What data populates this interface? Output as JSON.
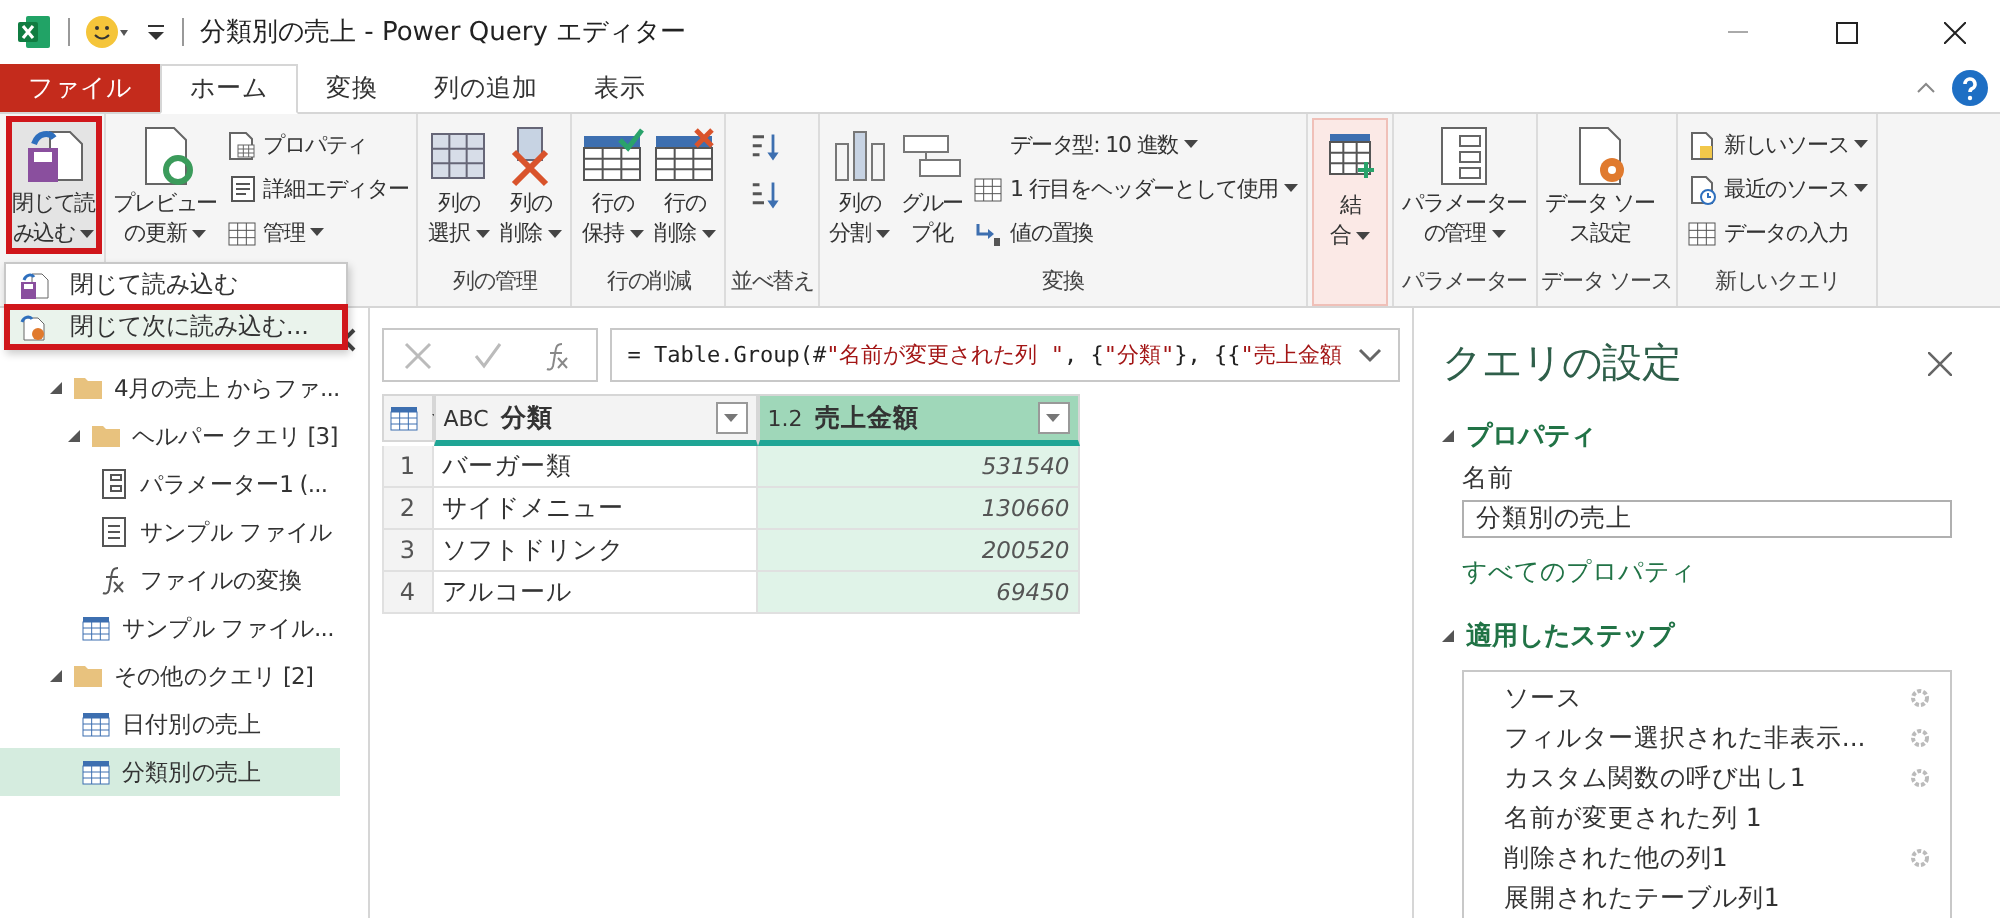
{
  "window": {
    "title": "分類別の売上 - Power Query エディター"
  },
  "tabs": [
    {
      "label": "ファイル",
      "kind": "file",
      "selected": false
    },
    {
      "label": "ホーム",
      "kind": "tab",
      "selected": true
    },
    {
      "label": "変換",
      "kind": "tab",
      "selected": false
    },
    {
      "label": "列の追加",
      "kind": "tab",
      "selected": false
    },
    {
      "label": "表示",
      "kind": "tab",
      "selected": false
    }
  ],
  "ribbon": [
    {
      "items": [
        {
          "kind": "large",
          "lines": [
            "閉じて読",
            "み込む"
          ],
          "dropdown": true,
          "highlighted": true,
          "hovered": false
        }
      ]
    },
    {
      "items": [
        {
          "kind": "large",
          "lines": [
            "プレビュー",
            "の更新"
          ],
          "dropdown": true,
          "highlighted": false,
          "hovered": false
        },
        {
          "kind": "stack",
          "items": [
            {
              "label": "プロパティ",
              "dropdown": false
            },
            {
              "label": "詳細エディター",
              "dropdown": false
            },
            {
              "label": "管理",
              "dropdown": true
            }
          ]
        }
      ]
    },
    {
      "label": "列の管理",
      "items": [
        {
          "kind": "large",
          "lines": [
            "列の",
            "選択"
          ],
          "dropdown": true,
          "highlighted": false,
          "hovered": false
        },
        {
          "kind": "large",
          "lines": [
            "列の",
            "削除"
          ],
          "dropdown": true,
          "highlighted": false,
          "hovered": false
        }
      ]
    },
    {
      "label": "行の削減",
      "items": [
        {
          "kind": "large",
          "lines": [
            "行の",
            "保持"
          ],
          "dropdown": true,
          "highlighted": false,
          "hovered": false
        },
        {
          "kind": "large",
          "lines": [
            "行の",
            "削除"
          ],
          "dropdown": true,
          "highlighted": false,
          "hovered": false
        }
      ]
    },
    {
      "label": "並べ替え",
      "items": [
        {
          "kind": "sort"
        }
      ]
    },
    {
      "label": "変換",
      "items": [
        {
          "kind": "large",
          "lines": [
            "列の",
            "分割"
          ],
          "dropdown": true,
          "highlighted": false,
          "hovered": false
        },
        {
          "kind": "large",
          "lines": [
            "グルー",
            "プ化"
          ],
          "dropdown": false,
          "highlighted": false,
          "hovered": false
        },
        {
          "kind": "stack",
          "items": [
            {
              "label": "データ型: 10 進数",
              "dropdown": true
            },
            {
              "label": "1 行目をヘッダーとして使用",
              "dropdown": true
            },
            {
              "label": "値の置換",
              "dropdown": false
            }
          ]
        }
      ]
    },
    {
      "items": [
        {
          "kind": "large",
          "lines": [
            "結",
            "合"
          ],
          "dropdown": true,
          "highlighted": false,
          "hovered": true
        }
      ]
    },
    {
      "label": "パラメーター",
      "items": [
        {
          "kind": "large",
          "lines": [
            "パラメーター",
            "の管理"
          ],
          "dropdown": true,
          "highlighted": false,
          "hovered": false
        }
      ]
    },
    {
      "label": "データ ソース",
      "items": [
        {
          "kind": "large",
          "lines": [
            "データ ソー",
            "ス設定"
          ],
          "dropdown": false,
          "highlighted": false,
          "hovered": false
        }
      ]
    },
    {
      "label": "新しいクエリ",
      "items": [
        {
          "kind": "stack",
          "items": [
            {
              "label": "新しいソース",
              "dropdown": true
            },
            {
              "label": "最近のソース",
              "dropdown": true
            },
            {
              "label": "データの入力",
              "dropdown": false
            }
          ]
        }
      ]
    }
  ],
  "menu": [
    {
      "label": "閉じて読み込む",
      "highlighted": false
    },
    {
      "label": "閉じて次に読み込む...",
      "highlighted": true
    }
  ],
  "queries": [
    {
      "label": "4月の売上 からファ...",
      "kind": "folder",
      "expanded": true,
      "children": [
        {
          "label": "ヘルパー クエリ [3]",
          "kind": "folder",
          "expanded": true,
          "children": [
            {
              "label": "パラメーター1 (...",
              "kind": "parameter",
              "selected": false
            },
            {
              "label": "サンプル ファイル",
              "kind": "list",
              "selected": false
            },
            {
              "label": "ファイルの変換",
              "kind": "function",
              "selected": false
            }
          ]
        },
        {
          "label": "サンプル ファイル...",
          "kind": "table",
          "selected": false
        }
      ]
    },
    {
      "label": "その他のクエリ [2]",
      "kind": "folder",
      "expanded": true,
      "children": [
        {
          "label": "日付別の売上",
          "kind": "table",
          "selected": false
        },
        {
          "label": "分類別の売上",
          "kind": "table",
          "selected": true
        }
      ]
    }
  ],
  "formula": [
    {
      "kind": "code",
      "text": "= Table.Group(#"
    },
    {
      "kind": "string",
      "text": "\"名前が変更された列 \""
    },
    {
      "kind": "code",
      "text": ", {"
    },
    {
      "kind": "string",
      "text": "\"分類\""
    },
    {
      "kind": "code",
      "text": "}, {{"
    },
    {
      "kind": "string",
      "text": "\"売上金額"
    }
  ],
  "table": {
    "columns": [
      {
        "type": "ABC",
        "name": "分類",
        "selected": false
      },
      {
        "type": "1.2",
        "name": "売上金額",
        "selected": true
      }
    ],
    "rows": [
      {
        "index": "1",
        "cells": [
          "バーガー類",
          "531540"
        ]
      },
      {
        "index": "2",
        "cells": [
          "サイドメニュー",
          "130660"
        ]
      },
      {
        "index": "3",
        "cells": [
          "ソフトドリンク",
          "200520"
        ]
      },
      {
        "index": "4",
        "cells": [
          "アルコール",
          "69450"
        ]
      }
    ]
  },
  "settings": {
    "title": "クエリの設定",
    "properties": {
      "heading": "プロパティ",
      "expanded": true,
      "name_label": "名前",
      "name_value": "分類別の売上",
      "link": "すべてのプロパティ"
    },
    "steps_section": {
      "heading": "適用したステップ",
      "expanded": true
    },
    "steps": [
      {
        "label": "ソース",
        "settings": true
      },
      {
        "label": "フィルター選択された非表示...",
        "settings": true
      },
      {
        "label": "カスタム関数の呼び出し1",
        "settings": true
      },
      {
        "label": "名前が変更された列 1",
        "settings": false
      },
      {
        "label": "削除された他の列1",
        "settings": true
      },
      {
        "label": "展開されたテーブル列1",
        "settings": false
      }
    ]
  }
}
